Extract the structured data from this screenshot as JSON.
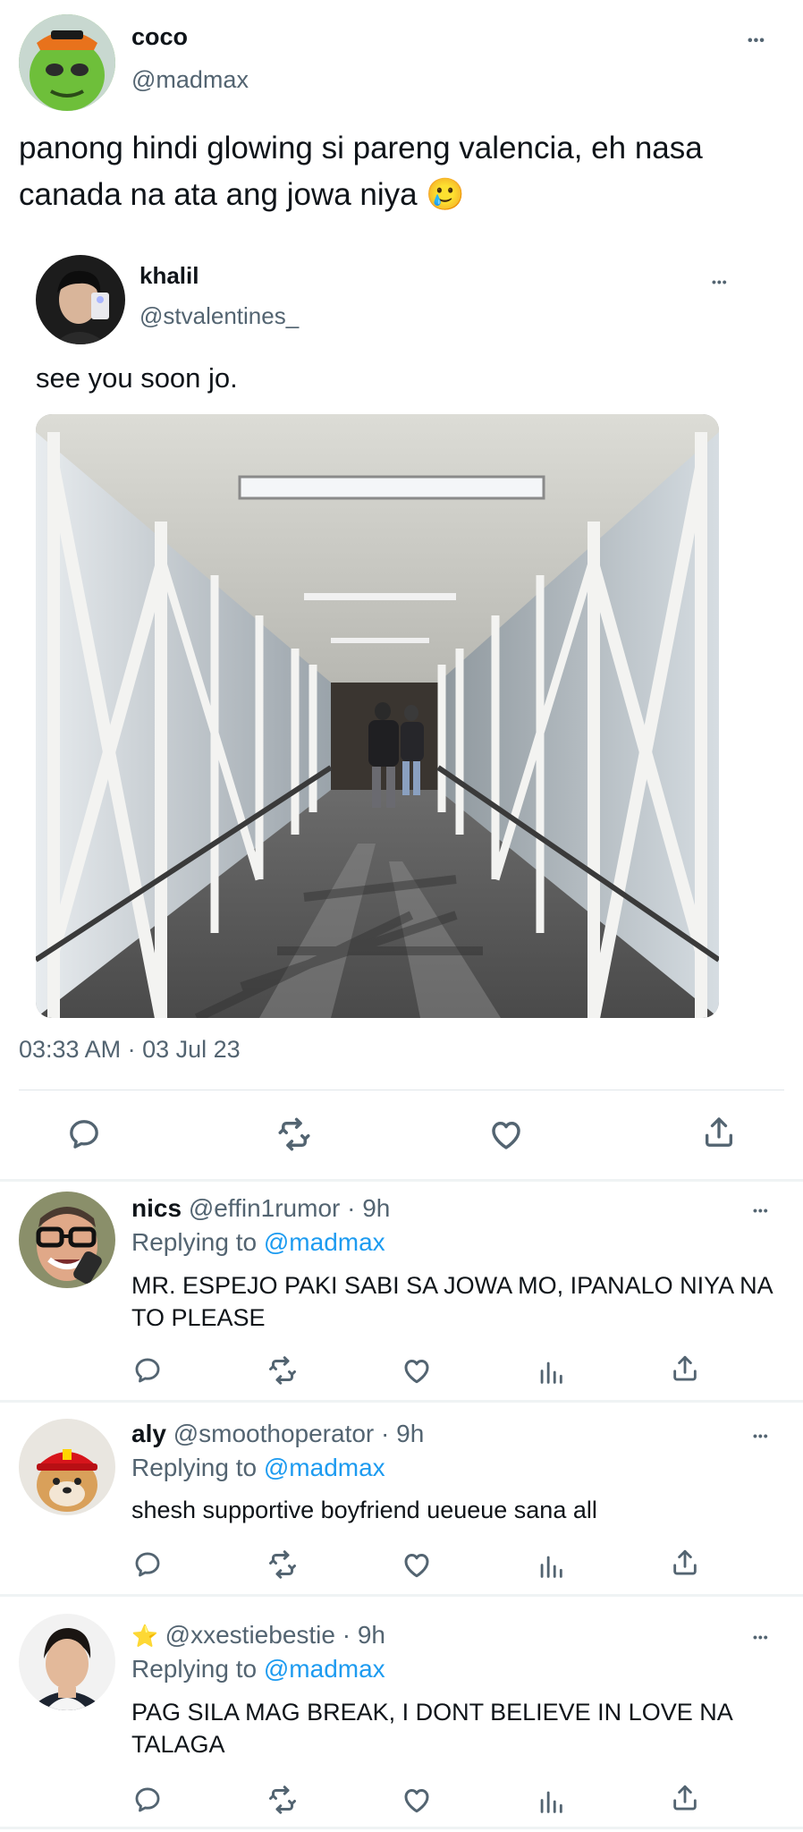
{
  "main_tweet": {
    "display_name": "coco",
    "handle": "@madmax",
    "text": "panong hindi glowing si pareng valencia, eh nasa canada na ata ang jowa niya 🥲",
    "timestamp": "03:33 AM · 03 Jul 23",
    "quoted": {
      "display_name": "khalil",
      "handle": "@stvalentines_",
      "text": "see you soon jo."
    }
  },
  "replies": [
    {
      "display_name": "nics",
      "handle": "@effin1rumor",
      "time": "· 9h",
      "replying_prefix": "Replying to",
      "replying_to": "@madmax",
      "text": "MR. ESPEJO PAKI SABI SA JOWA MO, IPANALO NIYA NA TO PLEASE"
    },
    {
      "display_name": "aly",
      "handle": "@smoothoperator",
      "time": "· 9h",
      "replying_prefix": "Replying to",
      "replying_to": "@madmax",
      "text": "shesh supportive boyfriend ueueue sana all"
    },
    {
      "display_name": "⭐",
      "handle": "@xxestiebestie",
      "time": "· 9h",
      "replying_prefix": "Replying to",
      "replying_to": "@madmax",
      "text": "PAG SILA MAG BREAK, I DONT BELIEVE IN LOVE NA TALAGA"
    }
  ],
  "more_label": "•••",
  "colors": {
    "text": "#0f1419",
    "secondary": "#536471",
    "accent": "#1d9bf0",
    "divider": "#eff3f4"
  }
}
